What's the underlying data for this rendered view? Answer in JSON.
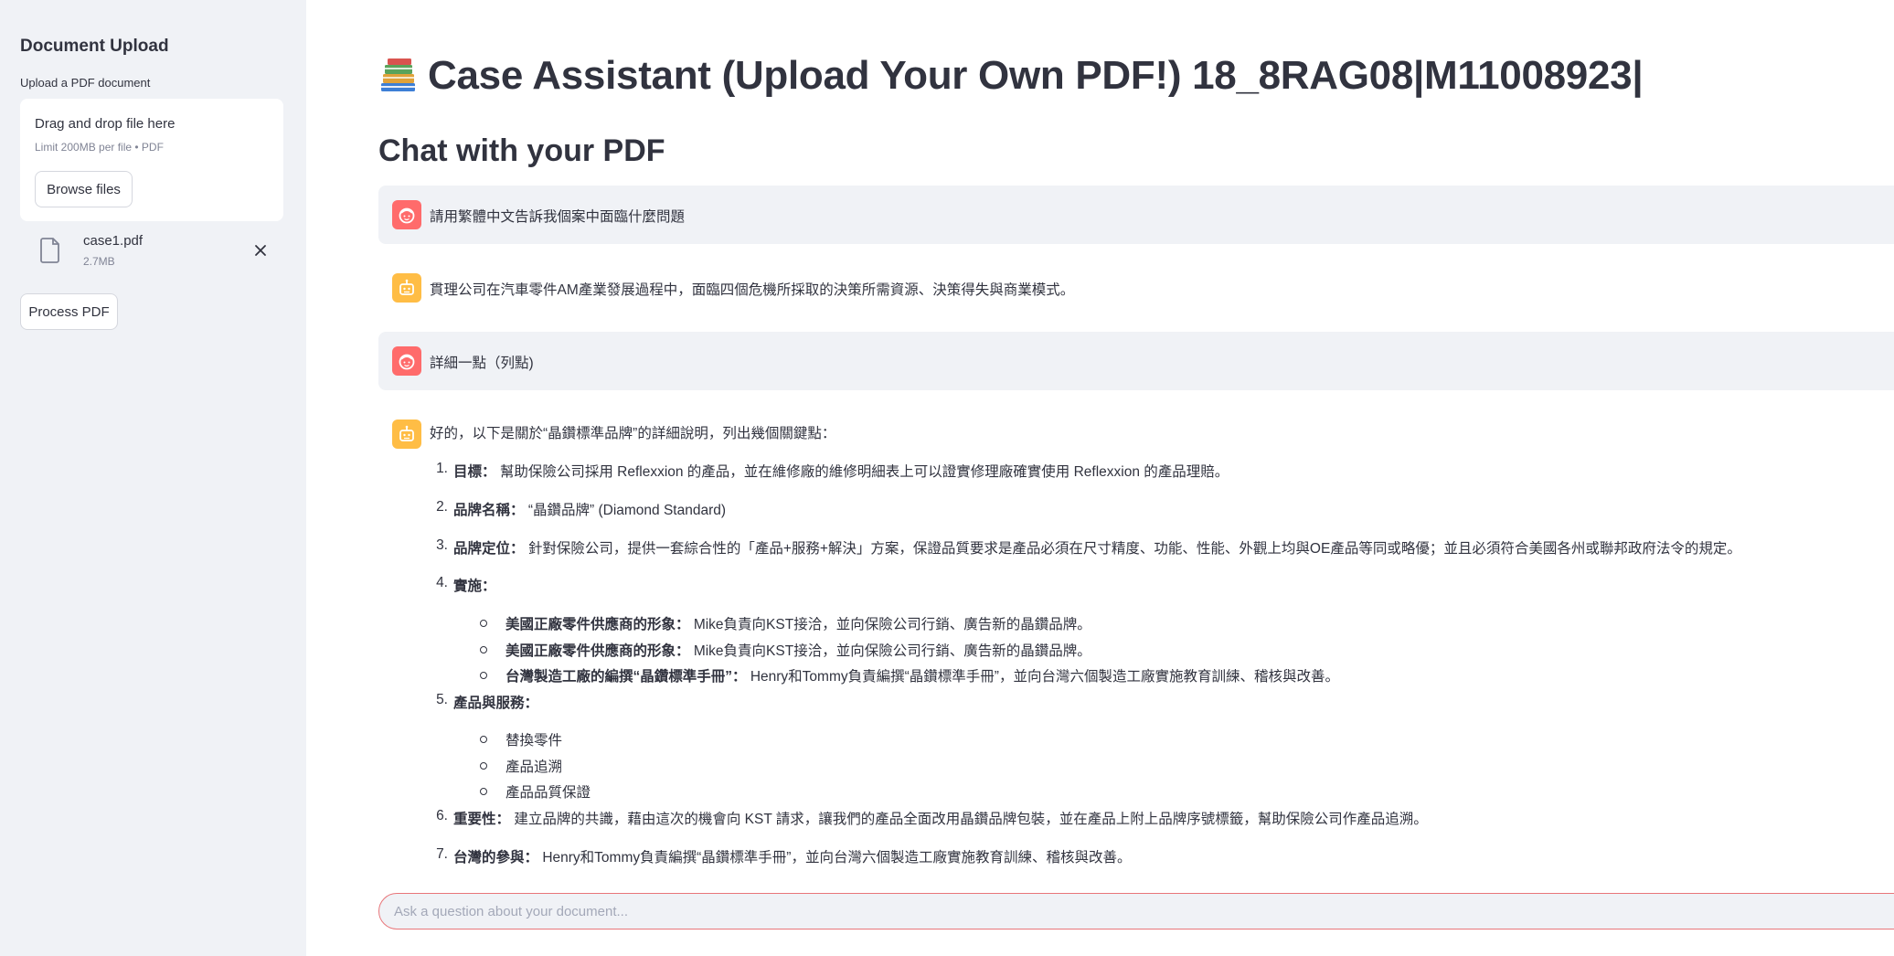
{
  "sidebar": {
    "title": "Document Upload",
    "upload_label": "Upload a PDF document",
    "dropzone_title": "Drag and drop file here",
    "dropzone_limit": "Limit 200MB per file • PDF",
    "browse_button": "Browse files",
    "file": {
      "name": "case1.pdf",
      "size": "2.7MB"
    },
    "process_button": "Process PDF"
  },
  "main": {
    "title_icon": "books-icon",
    "title": "Case Assistant (Upload Your Own PDF!) 18_8RAG08|M11008923|",
    "subtitle": "Chat with your PDF",
    "messages": [
      {
        "role": "user",
        "text": "請用繁體中文告訴我個案中面臨什麼問題"
      },
      {
        "role": "assistant",
        "text": "貫理公司在汽車零件AM產業發展過程中，面臨四個危機所採取的決策所需資源、決策得失與商業模式。"
      },
      {
        "role": "user",
        "text": "詳細一點（列點)"
      },
      {
        "role": "assistant",
        "intro": "好的，以下是關於“晶鑽標準品牌”的詳細說明，列出幾個關鍵點：",
        "items": [
          {
            "num": "1.",
            "label": "目標：",
            "text": "幫助保險公司採用 Reflexxion 的產品，並在維修廠的維修明細表上可以證實修理廠確實使用 Reflexxion 的產品理賠。"
          },
          {
            "num": "2.",
            "label": "品牌名稱：",
            "text": "“晶鑽品牌” (Diamond Standard)"
          },
          {
            "num": "3.",
            "label": "品牌定位：",
            "text": "針對保險公司，提供一套綜合性的「產品+服務+解決」方案，保證品質要求是產品必須在尺寸精度、功能、性能、外觀上均與OE產品等同或略優；並且必須符合美國各州或聯邦政府法令的規定。"
          },
          {
            "num": "4.",
            "label": "實施：",
            "text": ""
          },
          {
            "num": "5.",
            "label": "產品與服務：",
            "text": ""
          },
          {
            "num": "6.",
            "label": "重要性：",
            "text": "建立品牌的共識，藉由這次的機會向 KST 請求，讓我們的產品全面改用晶鑽品牌包裝，並在產品上附上品牌序號標籤，幫助保險公司作產品追溯。"
          },
          {
            "num": "7.",
            "label": "台灣的參與：",
            "text": "Henry和Tommy負責編撰“晶鑽標準手冊”，並向台灣六個製造工廠實施教育訓練、稽核與改善。"
          }
        ],
        "implementation": [
          {
            "label": "美國正廠零件供應商的形象：",
            "text": "Mike負責向KST接洽，並向保險公司行銷、廣告新的晶鑽品牌。"
          },
          {
            "label": "美國正廠零件供應商的形象：",
            "text": "Mike負責向KST接洽，並向保險公司行銷、廣告新的晶鑽品牌。"
          },
          {
            "label": "台灣製造工廠的編撰“晶鑽標準手冊”：",
            "text": "Henry和Tommy負責編撰“晶鑽標準手冊”，並向台灣六個製造工廠實施教育訓練、稽核與改善。"
          }
        ],
        "products": [
          "替換零件",
          "產品追溯",
          "產品品質保證"
        ]
      }
    ],
    "chat_placeholder": "Ask a question about your document..."
  },
  "colors": {
    "sidebar_bg": "#f0f2f6",
    "user_avatar": "#ff6b6b",
    "assistant_avatar": "#ffbd45",
    "input_border": "#e8767a"
  }
}
